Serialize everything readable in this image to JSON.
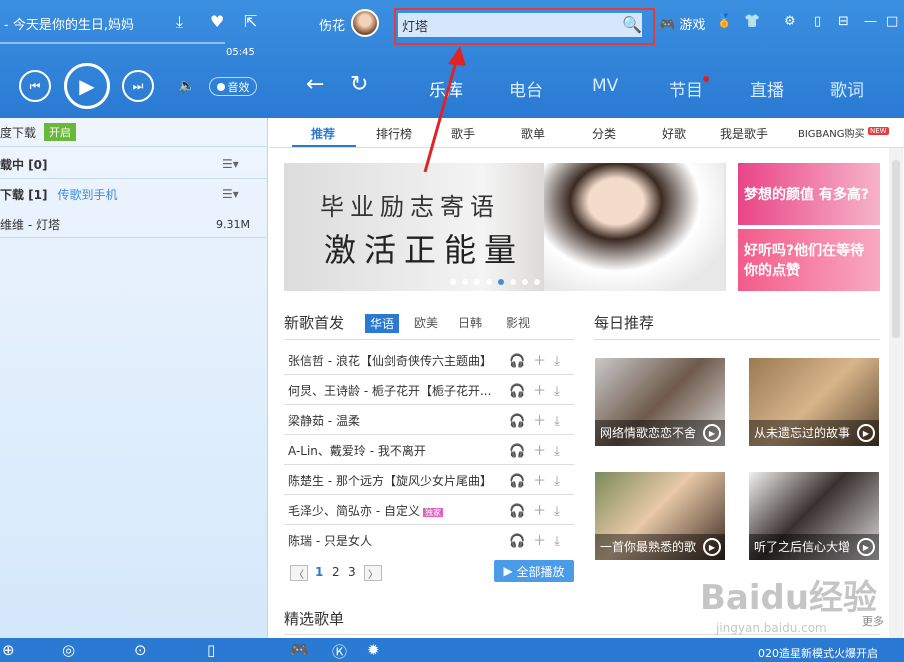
{
  "player": {
    "song_title": "今天是你的生日,妈妈",
    "time": "05:45",
    "sound_effect_label": "音效"
  },
  "header": {
    "username": "伤花",
    "search_value": "灯塔",
    "game_label": "游戏"
  },
  "nav": {
    "items": [
      "乐库",
      "电台",
      "MV",
      "节目",
      "直播",
      "歌词"
    ]
  },
  "sidebar": {
    "row1_text": "度下载",
    "row1_badge": "开启",
    "downloading": "载中 [0]",
    "downloaded": "下载 [1]",
    "transfer": "传歌到手机",
    "file_name": "维维 - 灯塔",
    "file_size": "9.31M"
  },
  "tabs": [
    "推荐",
    "排行榜",
    "歌手",
    "歌单",
    "分类",
    "好歌",
    "我是歌手",
    "BIGBANG购买"
  ],
  "new_badge": "NEW",
  "banner": {
    "line1": "毕业励志寄语",
    "line2": "激活正能量"
  },
  "ads": [
    "梦想的颜值 有多高?",
    "好听吗?他们在等待 你的点赞"
  ],
  "new_songs": {
    "title": "新歌首发",
    "langs": [
      "华语",
      "欧美",
      "日韩",
      "影视"
    ],
    "songs": [
      "张信哲 - 浪花【仙剑奇侠传六主题曲】",
      "何炅、王诗龄 - 栀子花开【栀子花开...",
      "梁静茹 - 温柔",
      "A-Lin、戴爱玲 - 我不离开",
      "陈楚生 - 那个远方【旋风少女片尾曲】",
      "毛泽少、简弘亦 - 自定义",
      "陈瑞 - 只是女人"
    ],
    "exclusive": "独家",
    "pages": [
      "1",
      "2",
      "3"
    ],
    "play_all": "全部播放"
  },
  "daily": {
    "title": "每日推荐",
    "cards": [
      "网络情歌恋恋不舍",
      "从未遗忘过的故事",
      "一首你最熟悉的歌",
      "听了之后信心大增"
    ]
  },
  "playlists_title": "精选歌单",
  "more": "更多",
  "footer": {
    "text": "020造星新模式火爆开启"
  },
  "watermark": "Baidu经验",
  "watermark_sub": "jingyan.baidu.com"
}
